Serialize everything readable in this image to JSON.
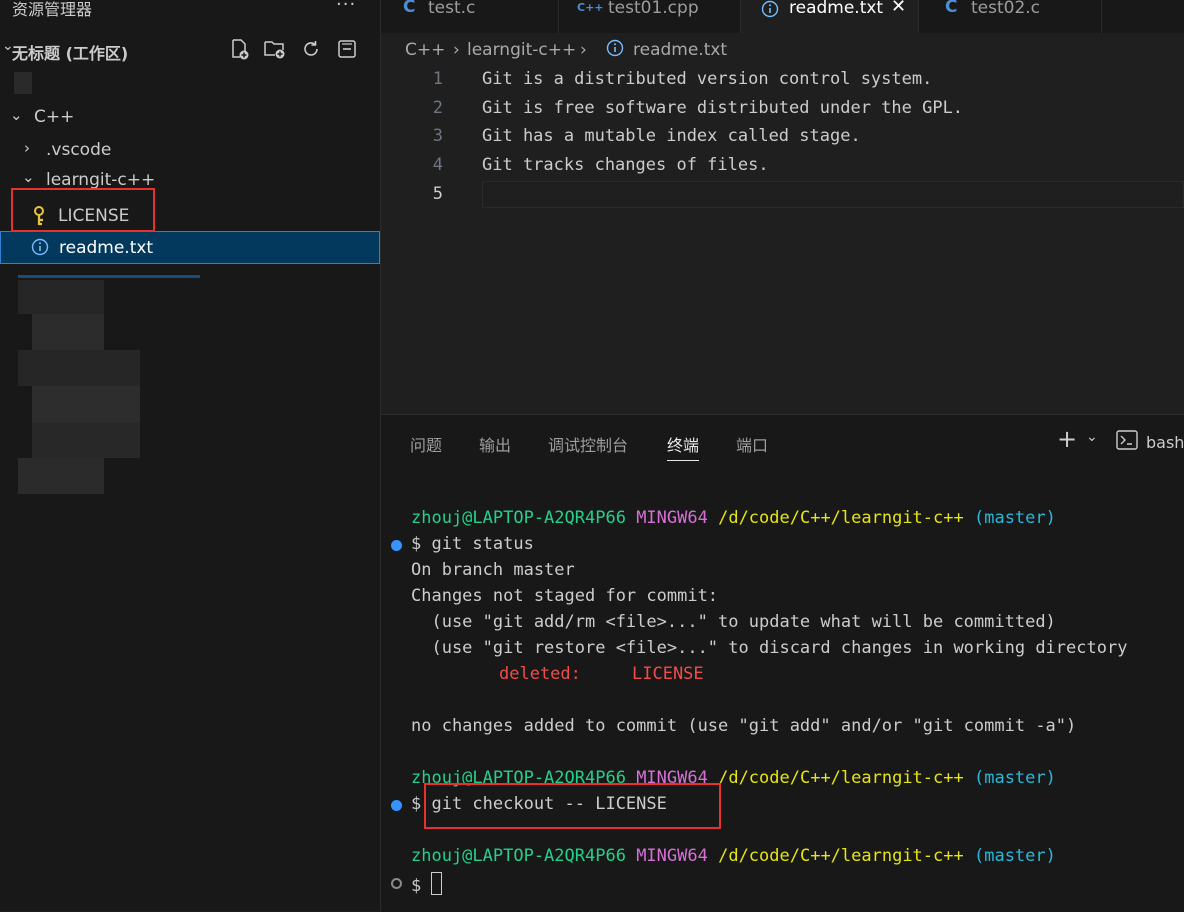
{
  "sidebar": {
    "title": "资源管理器",
    "more": "···",
    "workspace_label": "无标题 (工作区)",
    "tree": {
      "root_label": "C++",
      "vscode_label": ".vscode",
      "learngit_label": "learngit-c++",
      "license_label": "LICENSE",
      "readme_label": "readme.txt"
    }
  },
  "editor": {
    "tabs": [
      {
        "icon": "C",
        "label": "test.c"
      },
      {
        "icon": "C++",
        "label": "test01.cpp"
      },
      {
        "icon": "info",
        "label": "readme.txt",
        "close": "✕"
      },
      {
        "icon": "C",
        "label": "test02.c"
      }
    ],
    "breadcrumb": {
      "part1": "C++",
      "part2": "learngit-c++",
      "part3": "readme.txt",
      "sep": "›"
    },
    "lines": [
      {
        "num": "1",
        "text": "Git is a distributed version control system."
      },
      {
        "num": "2",
        "text": "Git is free software distributed under the GPL."
      },
      {
        "num": "3",
        "text": "Git has a mutable index called stage."
      },
      {
        "num": "4",
        "text": "Git tracks changes of files."
      },
      {
        "num": "5",
        "text": ""
      }
    ]
  },
  "panel": {
    "tabs": [
      "问题",
      "输出",
      "调试控制台",
      "终端",
      "端口"
    ],
    "add": "+",
    "shell_label": "bash"
  },
  "terminal": {
    "prompt_user": "zhouj@LAPTOP-A2QR4P66",
    "prompt_env": "MINGW64",
    "prompt_path": "/d/code/C++/learngit-c++",
    "prompt_branch": "(master)",
    "cmd1": "$ git status",
    "out1": "On branch master",
    "out2": "Changes not staged for commit:",
    "out3": "  (use \"git add/rm <file>...\" to update what will be committed)",
    "out4": "  (use \"git restore <file>...\" to discard changes in working directory",
    "deleted_label": "deleted:",
    "deleted_file": "LICENSE",
    "out5": "no changes added to commit (use \"git add\" and/or \"git commit -a\")",
    "cmd2": "$ git checkout -- LICENSE",
    "cmd3": "$ "
  }
}
